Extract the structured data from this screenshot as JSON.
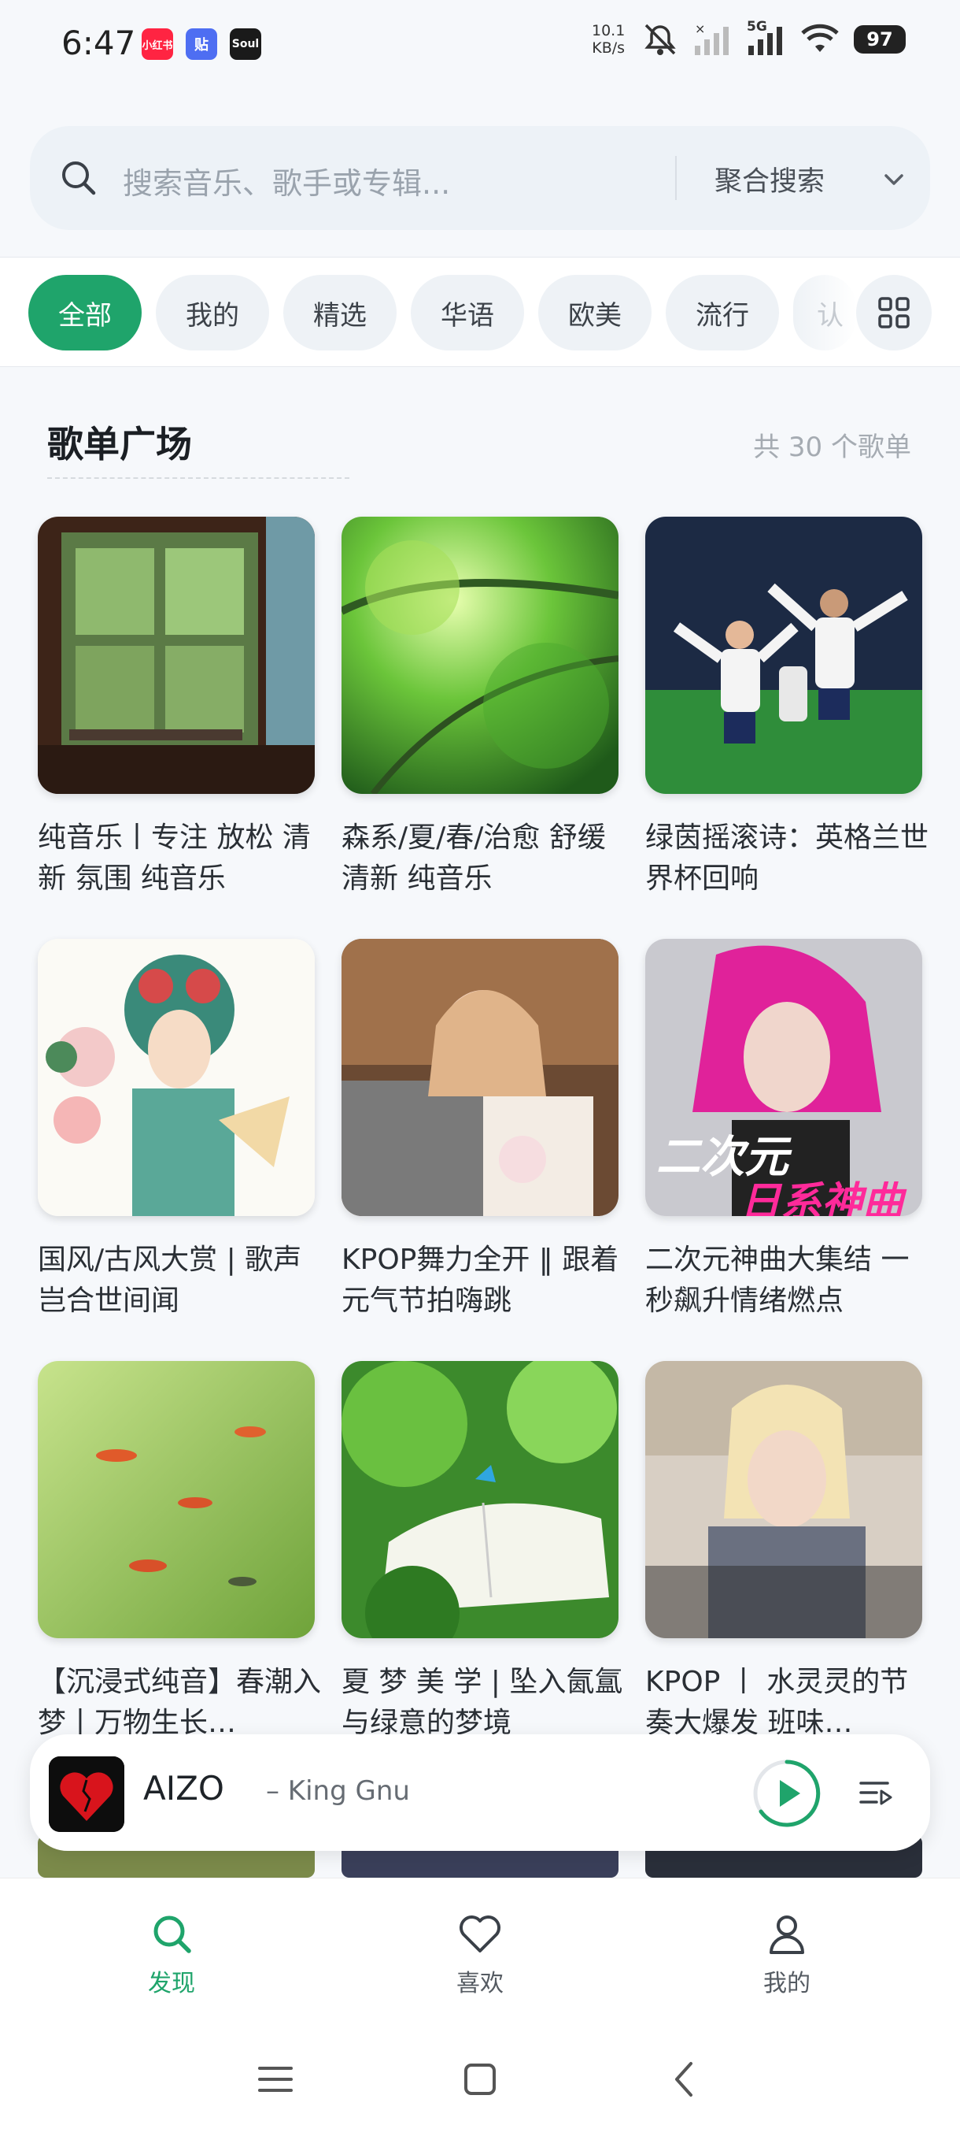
{
  "status_bar": {
    "time": "6:47",
    "apps": [
      {
        "label": "小红书",
        "color": "#ff2442"
      },
      {
        "label": "贴",
        "color": "#4e6ef2"
      },
      {
        "label": "Soul",
        "color": "#1a1a1a"
      }
    ],
    "net_speed_value": "10.1",
    "net_speed_unit": "KB/s",
    "network": "5G",
    "battery": "97"
  },
  "search": {
    "placeholder": "搜索音乐、歌手或专辑...",
    "mode": "聚合搜索"
  },
  "tabs": [
    {
      "label": "全部",
      "active": true
    },
    {
      "label": "我的"
    },
    {
      "label": "精选"
    },
    {
      "label": "华语"
    },
    {
      "label": "欧美"
    },
    {
      "label": "流行"
    },
    {
      "label": "认"
    }
  ],
  "section": {
    "title": "歌单广场",
    "count": "共 30 个歌单"
  },
  "playlists": [
    {
      "caption": "纯音乐丨专注 放松 清新 氛围 纯音乐"
    },
    {
      "caption": "森系/夏/春/治愈 舒缓 清新 纯音乐"
    },
    {
      "caption": "绿茵摇滚诗：英格兰世界杯回响"
    },
    {
      "caption": "国风/古风大赏 | 歌声岂合世间闻"
    },
    {
      "caption": "KPOP舞力全开 ‖ 跟着元气节拍嗨跳"
    },
    {
      "caption": "二次元神曲大集结 一秒飙升情绪燃点",
      "cover_text_1": "二次元",
      "cover_text_2": "日系神曲"
    },
    {
      "caption": "【沉浸式纯音】春潮入梦丨万物生长…"
    },
    {
      "caption": "夏 梦 美 学 | 坠入氤氲与绿意的梦境"
    },
    {
      "caption": "KPOP 丨 水灵灵的节奏大爆发 班味…"
    }
  ],
  "player": {
    "title": "AIZO",
    "artist": "– King Gnu",
    "accent": "#1fa46b"
  },
  "nav": {
    "discover": "发现",
    "favorites": "喜欢",
    "mine": "我的"
  }
}
